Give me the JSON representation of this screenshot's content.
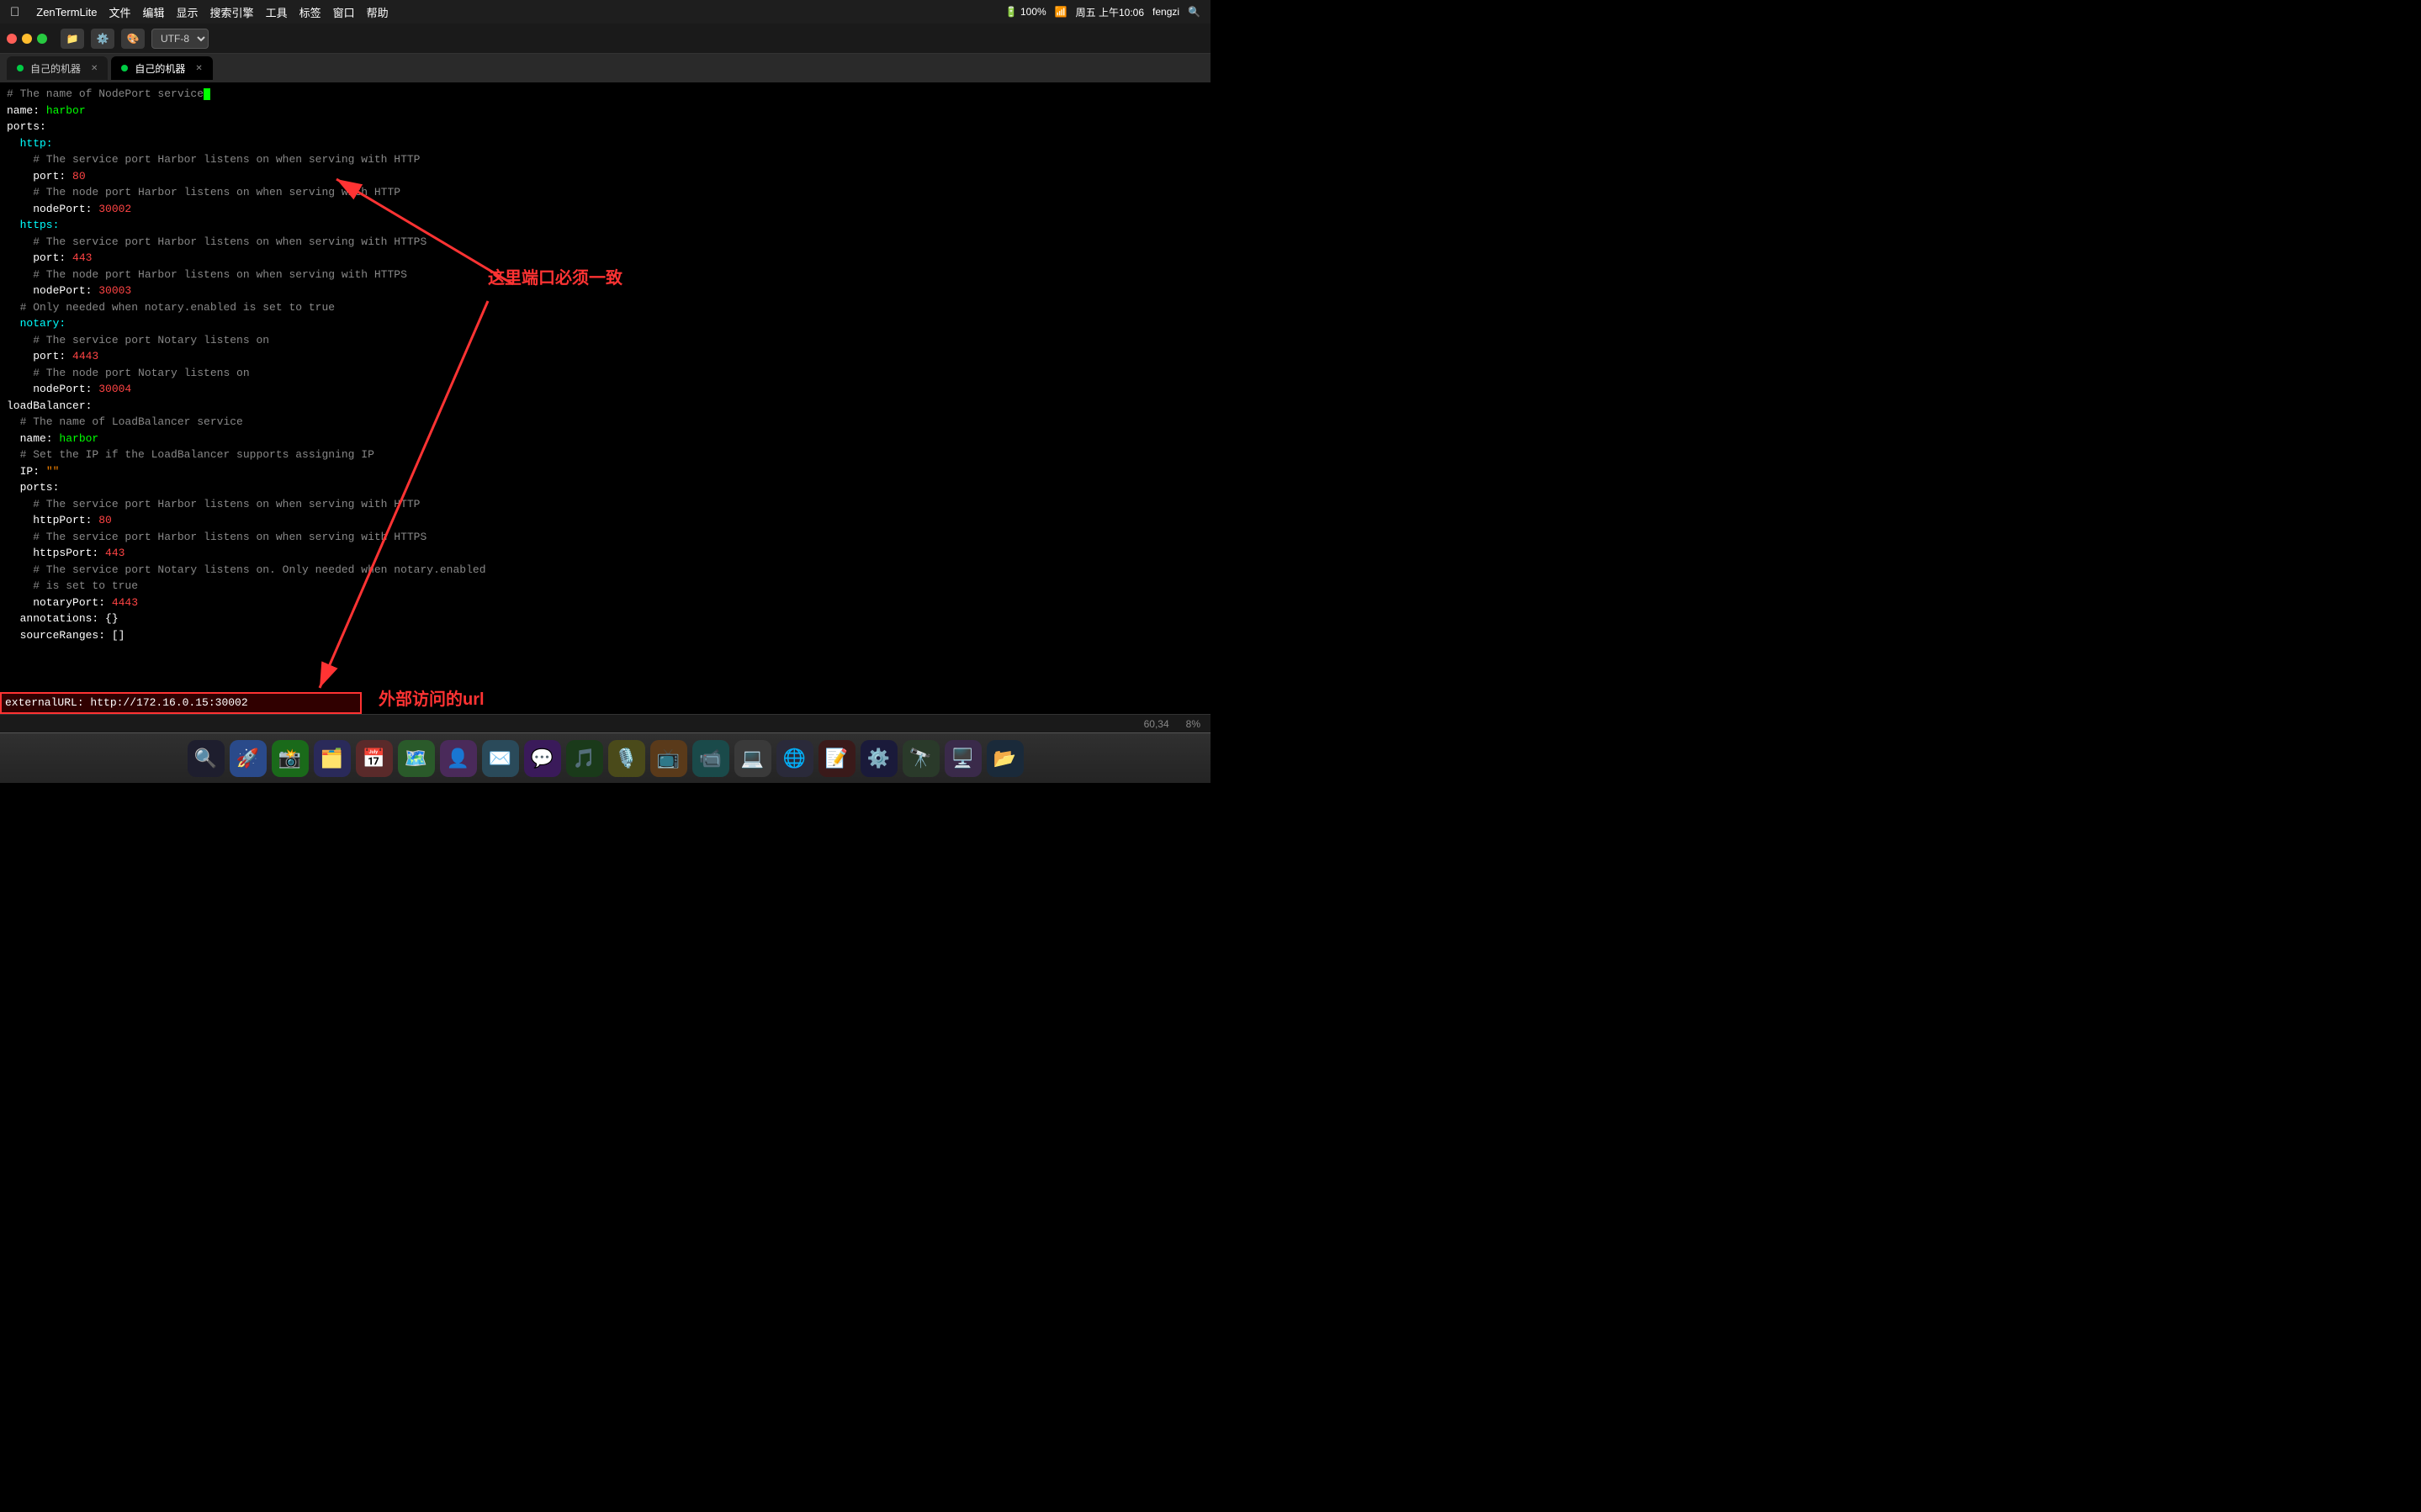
{
  "menubar": {
    "app_name": "ZenTermLite",
    "menus": [
      "文件",
      "编辑",
      "显示",
      "搜索引擎",
      "工具",
      "标签",
      "窗口",
      "帮助"
    ],
    "right_items": [
      "100%",
      "周五 上午10:06",
      "fengzi"
    ]
  },
  "toolbar": {
    "encoding": "UTF-8",
    "traffic": {
      "red": "close",
      "yellow": "minimize",
      "green": "maximize"
    }
  },
  "tabs": [
    {
      "label": "自己的机器",
      "active": false
    },
    {
      "label": "自己的机器",
      "active": true
    }
  ],
  "terminal": {
    "lines": [
      {
        "id": 1,
        "content": "# The name of NodePort service",
        "type": "comment"
      },
      {
        "id": 2,
        "content": "name: harbor",
        "key": "name",
        "val": "harbor"
      },
      {
        "id": 3,
        "content": "ports:",
        "type": "key"
      },
      {
        "id": 4,
        "content": "  http:",
        "type": "key"
      },
      {
        "id": 5,
        "content": "    # The service port Harbor listens on when serving with HTTP",
        "type": "comment"
      },
      {
        "id": 6,
        "content": "    port: 80",
        "key": "port",
        "val": "80"
      },
      {
        "id": 7,
        "content": "    # The node port Harbor listens on when serving with HTTP",
        "type": "comment"
      },
      {
        "id": 8,
        "content": "    nodePort: 30002",
        "key": "nodePort",
        "val": "30002"
      },
      {
        "id": 9,
        "content": "  https:",
        "type": "key"
      },
      {
        "id": 10,
        "content": "    # The service port Harbor listens on when serving with HTTPS",
        "type": "comment"
      },
      {
        "id": 11,
        "content": "    port: 443",
        "key": "port",
        "val": "443"
      },
      {
        "id": 12,
        "content": "    # The node port Harbor listens on when serving with HTTPS",
        "type": "comment"
      },
      {
        "id": 13,
        "content": "    nodePort: 30003",
        "key": "nodePort",
        "val": "30003"
      },
      {
        "id": 14,
        "content": "  # Only needed when notary.enabled is set to true",
        "type": "comment"
      },
      {
        "id": 15,
        "content": "  notary:",
        "type": "key"
      },
      {
        "id": 16,
        "content": "    # The service port Notary listens on",
        "type": "comment"
      },
      {
        "id": 17,
        "content": "    port: 4443",
        "key": "port",
        "val": "4443"
      },
      {
        "id": 18,
        "content": "    # The node port Notary listens on",
        "type": "comment"
      },
      {
        "id": 19,
        "content": "    nodePort: 30004",
        "key": "nodePort",
        "val": "30004"
      },
      {
        "id": 20,
        "content": "loadBalancer:",
        "type": "key"
      },
      {
        "id": 21,
        "content": "  # The name of LoadBalancer service",
        "type": "comment"
      },
      {
        "id": 22,
        "content": "  name: harbor",
        "key": "name",
        "val": "harbor"
      },
      {
        "id": 23,
        "content": "  # Set the IP if the LoadBalancer supports assigning IP",
        "type": "comment"
      },
      {
        "id": 24,
        "content": "  IP: \"\"",
        "key": "IP",
        "val": "\"\""
      },
      {
        "id": 25,
        "content": "  ports:",
        "type": "key"
      },
      {
        "id": 26,
        "content": "    # The service port Harbor listens on when serving with HTTP",
        "type": "comment"
      },
      {
        "id": 27,
        "content": "    httpPort: 80",
        "key": "httpPort",
        "val": "80"
      },
      {
        "id": 28,
        "content": "    # The service port Harbor listens on when serving with HTTPS",
        "type": "comment"
      },
      {
        "id": 29,
        "content": "    httpsPort: 443",
        "key": "httpsPort",
        "val": "443"
      },
      {
        "id": 30,
        "content": "    # The service port Notary listens on. Only needed when notary.enabled",
        "type": "comment"
      },
      {
        "id": 31,
        "content": "    # is set to true",
        "type": "comment"
      },
      {
        "id": 32,
        "content": "    notaryPort: 4443",
        "key": "notaryPort",
        "val": "4443"
      },
      {
        "id": 33,
        "content": "  annotations: {}",
        "key": "annotations",
        "val": "{}"
      },
      {
        "id": 34,
        "content": "  sourceRanges: []",
        "key": "sourceRanges",
        "val": "[]"
      }
    ],
    "externalURL": "externalURL:  http://172.16.0.15:30002",
    "cursor_pos": "60,34",
    "scroll_pct": "8%"
  },
  "annotations": {
    "port_note": "这里端口必须一致",
    "url_note": "外部访问的url"
  },
  "dock_icons": [
    "🔍",
    "🚀",
    "📱",
    "🖼️",
    "📅",
    "📍",
    "👤",
    "📨",
    "📞",
    "🎵",
    "🔧",
    "📺",
    "🎤",
    "💻",
    "🎵",
    "🎬",
    "🔴",
    "🌐",
    "⚙️",
    "🔗",
    "🔍",
    "⬜",
    "📝"
  ]
}
